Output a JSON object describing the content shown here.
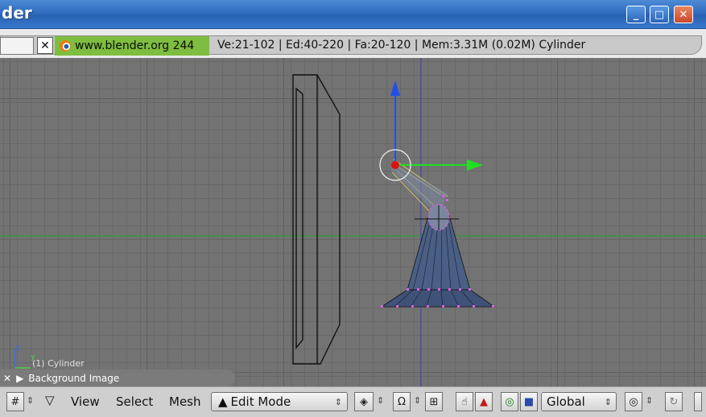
{
  "window": {
    "title": "der"
  },
  "window_controls": {
    "minimize": "_",
    "maximize": "□",
    "close": "✕"
  },
  "info": {
    "close_glyph": "✕",
    "site": "www.blender.org 244",
    "stats": "Ve:21-102 | Ed:40-220 | Fa:20-120 | Mem:3.31M (0.02M) Cylinder"
  },
  "viewport": {
    "object_label": "(1) Cylinder",
    "axis_z": "z",
    "axis_y": "y"
  },
  "panel": {
    "label": "Background Image"
  },
  "toolbar": {
    "view": "View",
    "select": "Select",
    "mesh": "Mesh",
    "mode": "Edit Mode",
    "orientation": "Global"
  },
  "colors": {
    "titlebar": "#2f6cc0",
    "info_green": "#7ebd3f",
    "viewport_bg": "#737373",
    "mesh_fill": "#4a5f85",
    "vertex_selected": "#e060e0",
    "axis_z": "#2040e0",
    "axis_y": "#20d020",
    "center_dot": "#e01010"
  }
}
